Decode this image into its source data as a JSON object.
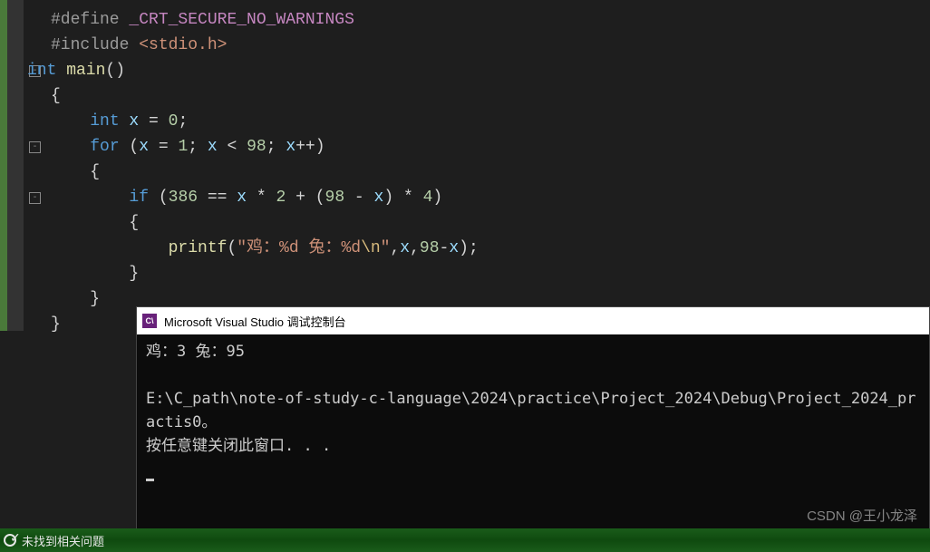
{
  "code": {
    "l1_define": "#define",
    "l1_macro": " _CRT_SECURE_NO_WARNINGS",
    "l2_include": "#include",
    "l2_angle_open": " <",
    "l2_header": "stdio.h",
    "l2_angle_close": ">",
    "l3_int": "int",
    "l3_main": " main",
    "l3_parens": "()",
    "l4_brace": "{",
    "l5_int": "int",
    "l5_x": " x",
    "l5_eq": " = ",
    "l5_zero": "0",
    "l5_semi": ";",
    "l6_for": "for",
    "l6_po": " (",
    "l6_x1": "x",
    "l6_eq1": " = ",
    "l6_one": "1",
    "l6_semi1": "; ",
    "l6_x2": "x",
    "l6_lt": " < ",
    "l6_98": "98",
    "l6_semi2": "; ",
    "l6_x3": "x",
    "l6_inc": "++)",
    "l7_brace": "{",
    "l8_if": "if",
    "l8_po": " (",
    "l8_386": "386",
    "l8_eq": " == ",
    "l8_x1": "x",
    "l8_m2": " * ",
    "l8_two": "2",
    "l8_plus": " + (",
    "l8_98": "98",
    "l8_minus": " - ",
    "l8_x2": "x",
    "l8_cpm": ") * ",
    "l8_four": "4",
    "l8_cp": ")",
    "l9_brace": "{",
    "l10_printf": "printf",
    "l10_po": "(",
    "l10_str_open": "\"鸡：%d 兔：%d",
    "l10_esc": "\\n",
    "l10_str_close": "\"",
    "l10_comma": ",",
    "l10_x": "x",
    "l10_comma2": ",",
    "l10_98": "98",
    "l10_minus": "-",
    "l10_x2": "x",
    "l10_end": ");",
    "l11_brace": "}",
    "l12_brace": "}",
    "l13_brace": "}"
  },
  "console": {
    "title": "Microsoft Visual Studio 调试控制台",
    "line1": "鸡：3 兔：95",
    "line2": "E:\\C_path\\note-of-study-c-language\\2024\\practice\\Project_2024\\Debug\\Project_2024_practis0。",
    "line3": "按任意键关闭此窗口. . ."
  },
  "statusbar": {
    "text": "未找到相关问题"
  },
  "watermark": "CSDN @王小龙泽"
}
